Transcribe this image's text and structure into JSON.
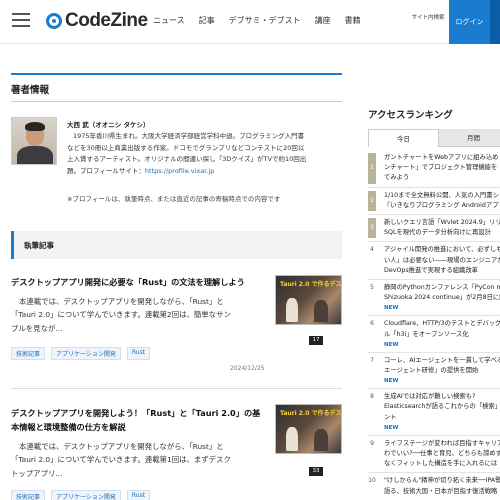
{
  "header": {
    "logo_text": "CodeZine",
    "nav": [
      "ニュース",
      "記事",
      "デブサミ・デブスト",
      "講座",
      "書籍"
    ],
    "site_button": "サイト内検索",
    "login_button": "ログイン"
  },
  "author_section": {
    "title": "著者情報",
    "name": "大西 武（オオニシ タケシ）",
    "bio_lines": [
      "1975年香川県生まれ。大阪大学経済学部経営学科中退。プログラミング入門書",
      "などを30冊以上商業出版する作家。ドコモでグランプリなどコンテストに20回以",
      "上入賞するアーティスト。オリジナルの間違い探し「3Dクイズ」がTVで約10回出",
      "題。プロフィールサイト："
    ],
    "profile_link": "https://profile.vixar.jp",
    "note": "※プロフィールは、執筆時点、または直近の記事の寄稿時点での内容です"
  },
  "articles_section": {
    "title": "執筆記事",
    "articles": [
      {
        "title": "デスクトップアプリ開発に必要な「Rust」の文法を理解しよう",
        "summary_lines": [
          "本連載では、デスクトップアプリを開発しながら、「Rust」と",
          "「Tauri 2.0」について学んでいきます。連載第2回は、簡単なサン",
          "プルを見なが…"
        ],
        "thumb_title": "Tauri 2.0 で作るデスクトップアプリ",
        "thumb_badge": "17",
        "tags": [
          "技術記事",
          "アプリケーション開発",
          "Rust"
        ],
        "date": "2024/12/25"
      },
      {
        "title_lines": [
          "デスクトップアプリを開発しよう！「Rust」と「Tauri 2.0」の基",
          "本情報と環境整備の仕方を解説"
        ],
        "summary_lines": [
          "本連載では、デスクトップアプリを開発しながら、「Rust」と",
          "「Tauri 2.0」について学んでいきます。連載第1回は、まずデスク",
          "トップアプリ…"
        ],
        "thumb_title": "Tauri 2.0 で作るデスクトップアプリ",
        "thumb_badge": "33",
        "tags": [
          "技術記事",
          "アプリケーション開発",
          "Rust"
        ]
      }
    ]
  },
  "ranking": {
    "title": "アクセスランキング",
    "tabs": [
      "今日",
      "月間"
    ],
    "items": [
      {
        "rank": "1",
        "lines": [
          "ガントチャートをWebアプリに組み込め",
          "ンチャート」でプロジェクト管理機能を",
          "てみよう"
        ],
        "new": ""
      },
      {
        "rank": "2",
        "lines": [
          "1/10まで全文無料公開、人気の入門書シ",
          "『いきなりプログラミング Androidアプリ"
        ],
        "new": ""
      },
      {
        "rank": "3",
        "lines": [
          "新しいクエリ言語「Wvlet 2024.9」リリー",
          "SQLを現代のデータ分析向けに再設計"
        ],
        "new": ""
      },
      {
        "rank": "4",
        "lines": [
          "アジャイル開発の推進において、必ずしも",
          "い人」は必要ない――現場のエンジニアが",
          "DevOps推進で実現する組織改革"
        ],
        "new": ""
      },
      {
        "rank": "5",
        "lines": [
          "静岡のPythonカンファレンス「PyCon mi",
          "Shizuoka 2024 continue」が2月8日に開催"
        ],
        "new": "NEW"
      },
      {
        "rank": "6",
        "lines": [
          "Cloudflare、HTTP/3のテストとデバッグ",
          "ル「h3i」をオープンソース化"
        ],
        "new": "NEW"
      },
      {
        "rank": "7",
        "lines": [
          "コーレ、AIエージェントを一貫して学べる",
          "エージェント研修」の提供を開始"
        ],
        "new": "NEW"
      },
      {
        "rank": "8",
        "lines": [
          "生成AIでは対応が難しい検索も?",
          "Elasticsearchが語るこれからの「検索」と",
          "ント"
        ],
        "new": "NEW"
      },
      {
        "rank": "9",
        "lines": [
          "ライフステージが変われば目指すキャリア",
          "わでいい?──仕事と育児、どちらも諦めず",
          "なくフィットした構造を手に入れるには"
        ],
        "new": ""
      },
      {
        "rank": "10",
        "lines": [
          "\"けしからん\"精神が切り拓く未来──IPA警",
          "語る、技術大国・日本が目指す復活戦略"
        ],
        "new": ""
      }
    ]
  }
}
